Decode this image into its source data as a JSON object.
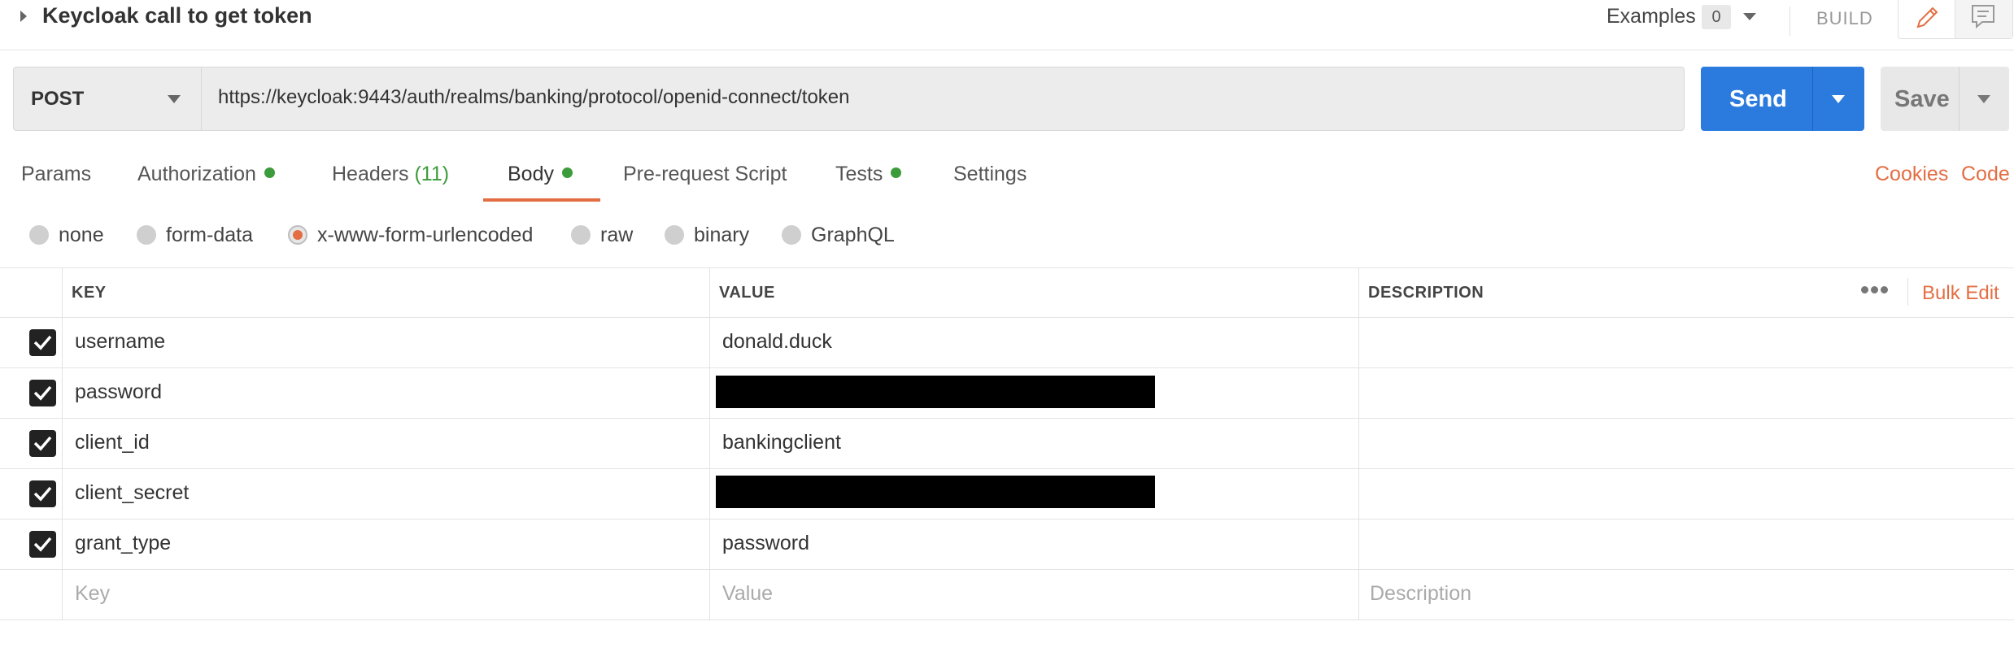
{
  "request": {
    "name": "Keycloak call to get token",
    "examples_label": "Examples",
    "examples_count": "0",
    "build_label": "BUILD",
    "method": "POST",
    "url": "https://keycloak:9443/auth/realms/banking/protocol/openid-connect/token",
    "send_label": "Send",
    "save_label": "Save"
  },
  "tabs": [
    {
      "label": "Params"
    },
    {
      "label": "Authorization"
    },
    {
      "label": "Headers",
      "count": "(11)"
    },
    {
      "label": "Body"
    },
    {
      "label": "Pre-request Script"
    },
    {
      "label": "Tests"
    },
    {
      "label": "Settings"
    }
  ],
  "active_tab": "Body",
  "right_links": {
    "cookies": "Cookies",
    "code": "Code"
  },
  "body_types": [
    "none",
    "form-data",
    "x-www-form-urlencoded",
    "raw",
    "binary",
    "GraphQL"
  ],
  "selected_body_type": "x-www-form-urlencoded",
  "table": {
    "headers": {
      "key": "KEY",
      "value": "VALUE",
      "description": "DESCRIPTION"
    },
    "bulk_edit": "Bulk Edit",
    "rows": [
      {
        "checked": true,
        "key": "username",
        "value": "donald.duck",
        "redacted": false
      },
      {
        "checked": true,
        "key": "password",
        "value": "",
        "redacted": true
      },
      {
        "checked": true,
        "key": "client_id",
        "value": "bankingclient",
        "redacted": false
      },
      {
        "checked": true,
        "key": "client_secret",
        "value": "",
        "redacted": true
      },
      {
        "checked": true,
        "key": "grant_type",
        "value": "password",
        "redacted": false
      }
    ],
    "placeholders": {
      "key": "Key",
      "value": "Value",
      "description": "Description"
    }
  },
  "colors": {
    "accent": "#e36e43",
    "primary": "#2b7bde",
    "status_dot": "#3c9c3c"
  }
}
